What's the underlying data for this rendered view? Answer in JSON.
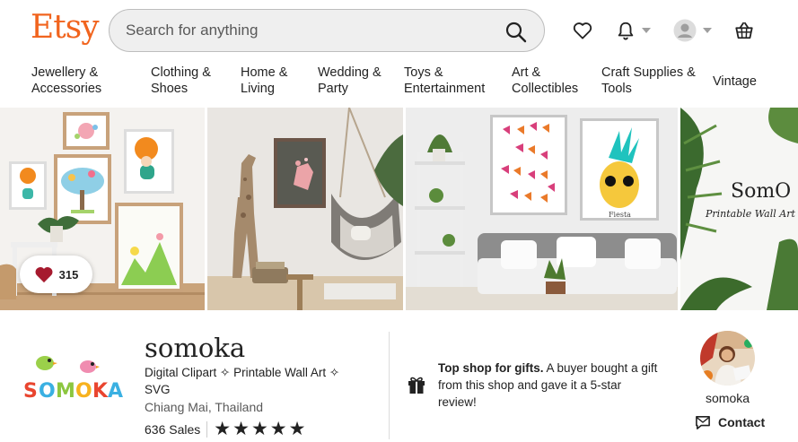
{
  "header": {
    "logo": "Etsy",
    "search_placeholder": "Search for anything"
  },
  "nav": {
    "items": [
      {
        "line1": "Jewellery &",
        "line2": "Accessories"
      },
      {
        "line1": "Clothing &",
        "line2": "Shoes"
      },
      {
        "line1": "Home &",
        "line2": "Living"
      },
      {
        "line1": "Wedding &",
        "line2": "Party"
      },
      {
        "line1": "Toys &",
        "line2": "Entertainment"
      },
      {
        "line1": "Art &",
        "line2": "Collectibles"
      },
      {
        "line1": "Craft Supplies &",
        "line2": "Tools"
      },
      {
        "line1": "Vintage",
        "line2": ""
      }
    ]
  },
  "hero": {
    "favorites_count": "315",
    "banner_text_1": "SomO",
    "banner_text_2": "Printable Wall Art",
    "poster_text": "Fiesta"
  },
  "shop": {
    "logo_text": "SOMOKA",
    "name": "somoka",
    "title": "Digital Clipart ✧ Printable Wall Art ✧ SVG",
    "location": "Chiang Mai, Thailand",
    "sales": "636 Sales",
    "rating": 5
  },
  "gift_banner": {
    "bold": "Top shop for gifts.",
    "text": " A buyer bought a gift from this shop and gave it a 5-star review!"
  },
  "owner": {
    "name": "somoka",
    "contact_label": "Contact"
  },
  "colors": {
    "brand": "#F1641E",
    "heart": "#A61A2E"
  }
}
